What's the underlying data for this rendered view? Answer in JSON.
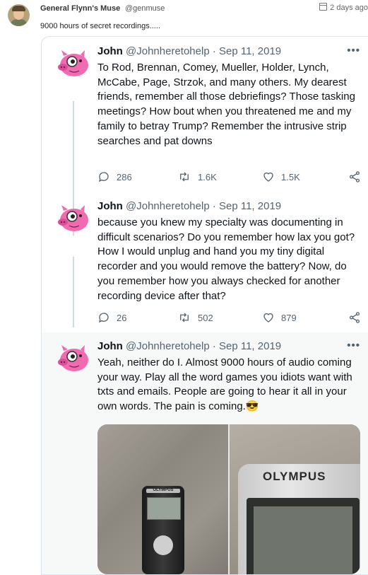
{
  "post": {
    "author_name": "General Flynn's Muse",
    "author_handle": "@genmuse",
    "date": "2 days ago",
    "text": "9000 hours of secret recordings....."
  },
  "embed": {
    "tweets": [
      {
        "name": "John",
        "handle": "@Johnheretohelp",
        "date": "· Sep 11, 2019",
        "body": "To Rod, Brennan, Comey, Mueller, Holder, Lynch, McCabe, Page, Strzok, and many others. My dearest friends, remember all those debriefings? Those tasking meetings? How bout when you threatened me and my family to betray Trump? Remember the intrusive strip searches and pat downs",
        "replies": "286",
        "retweets": "1.6K",
        "likes": "1.5K"
      },
      {
        "name": "John",
        "handle": "@Johnheretohelp",
        "date": "· Sep 11, 2019",
        "body": "because you knew my specialty was documenting in difficult scenarios? Do you remember how lax you got? How I would unplug and hand you my tiny digital recorder and you would remove the battery? Now, do you remember how you always checked for another recording device after that?",
        "replies": "26",
        "retweets": "502",
        "likes": "879"
      },
      {
        "name": "John",
        "handle": "@Johnheretohelp",
        "date": "· Sep 11, 2019",
        "body": "Yeah, neither do I. Almost 9000 hours of audio coming your way. Play all the word games you idiots want with txts and emails. People are going to hear it all in your own words. The pain is coming.",
        "emoji": "😎"
      }
    ],
    "media": {
      "left_brand": "OLYMPUS",
      "right_brand": "OLYMPUS"
    }
  },
  "icons": {
    "reply": "reply-icon",
    "retweet": "retweet-icon",
    "like": "heart-icon",
    "share": "share-icon",
    "more": "more-icon",
    "calendar": "calendar-icon"
  },
  "colors": {
    "muted": "#536471",
    "thread_line": "#cfd9de",
    "avatar_pink": "#f06bb0"
  }
}
